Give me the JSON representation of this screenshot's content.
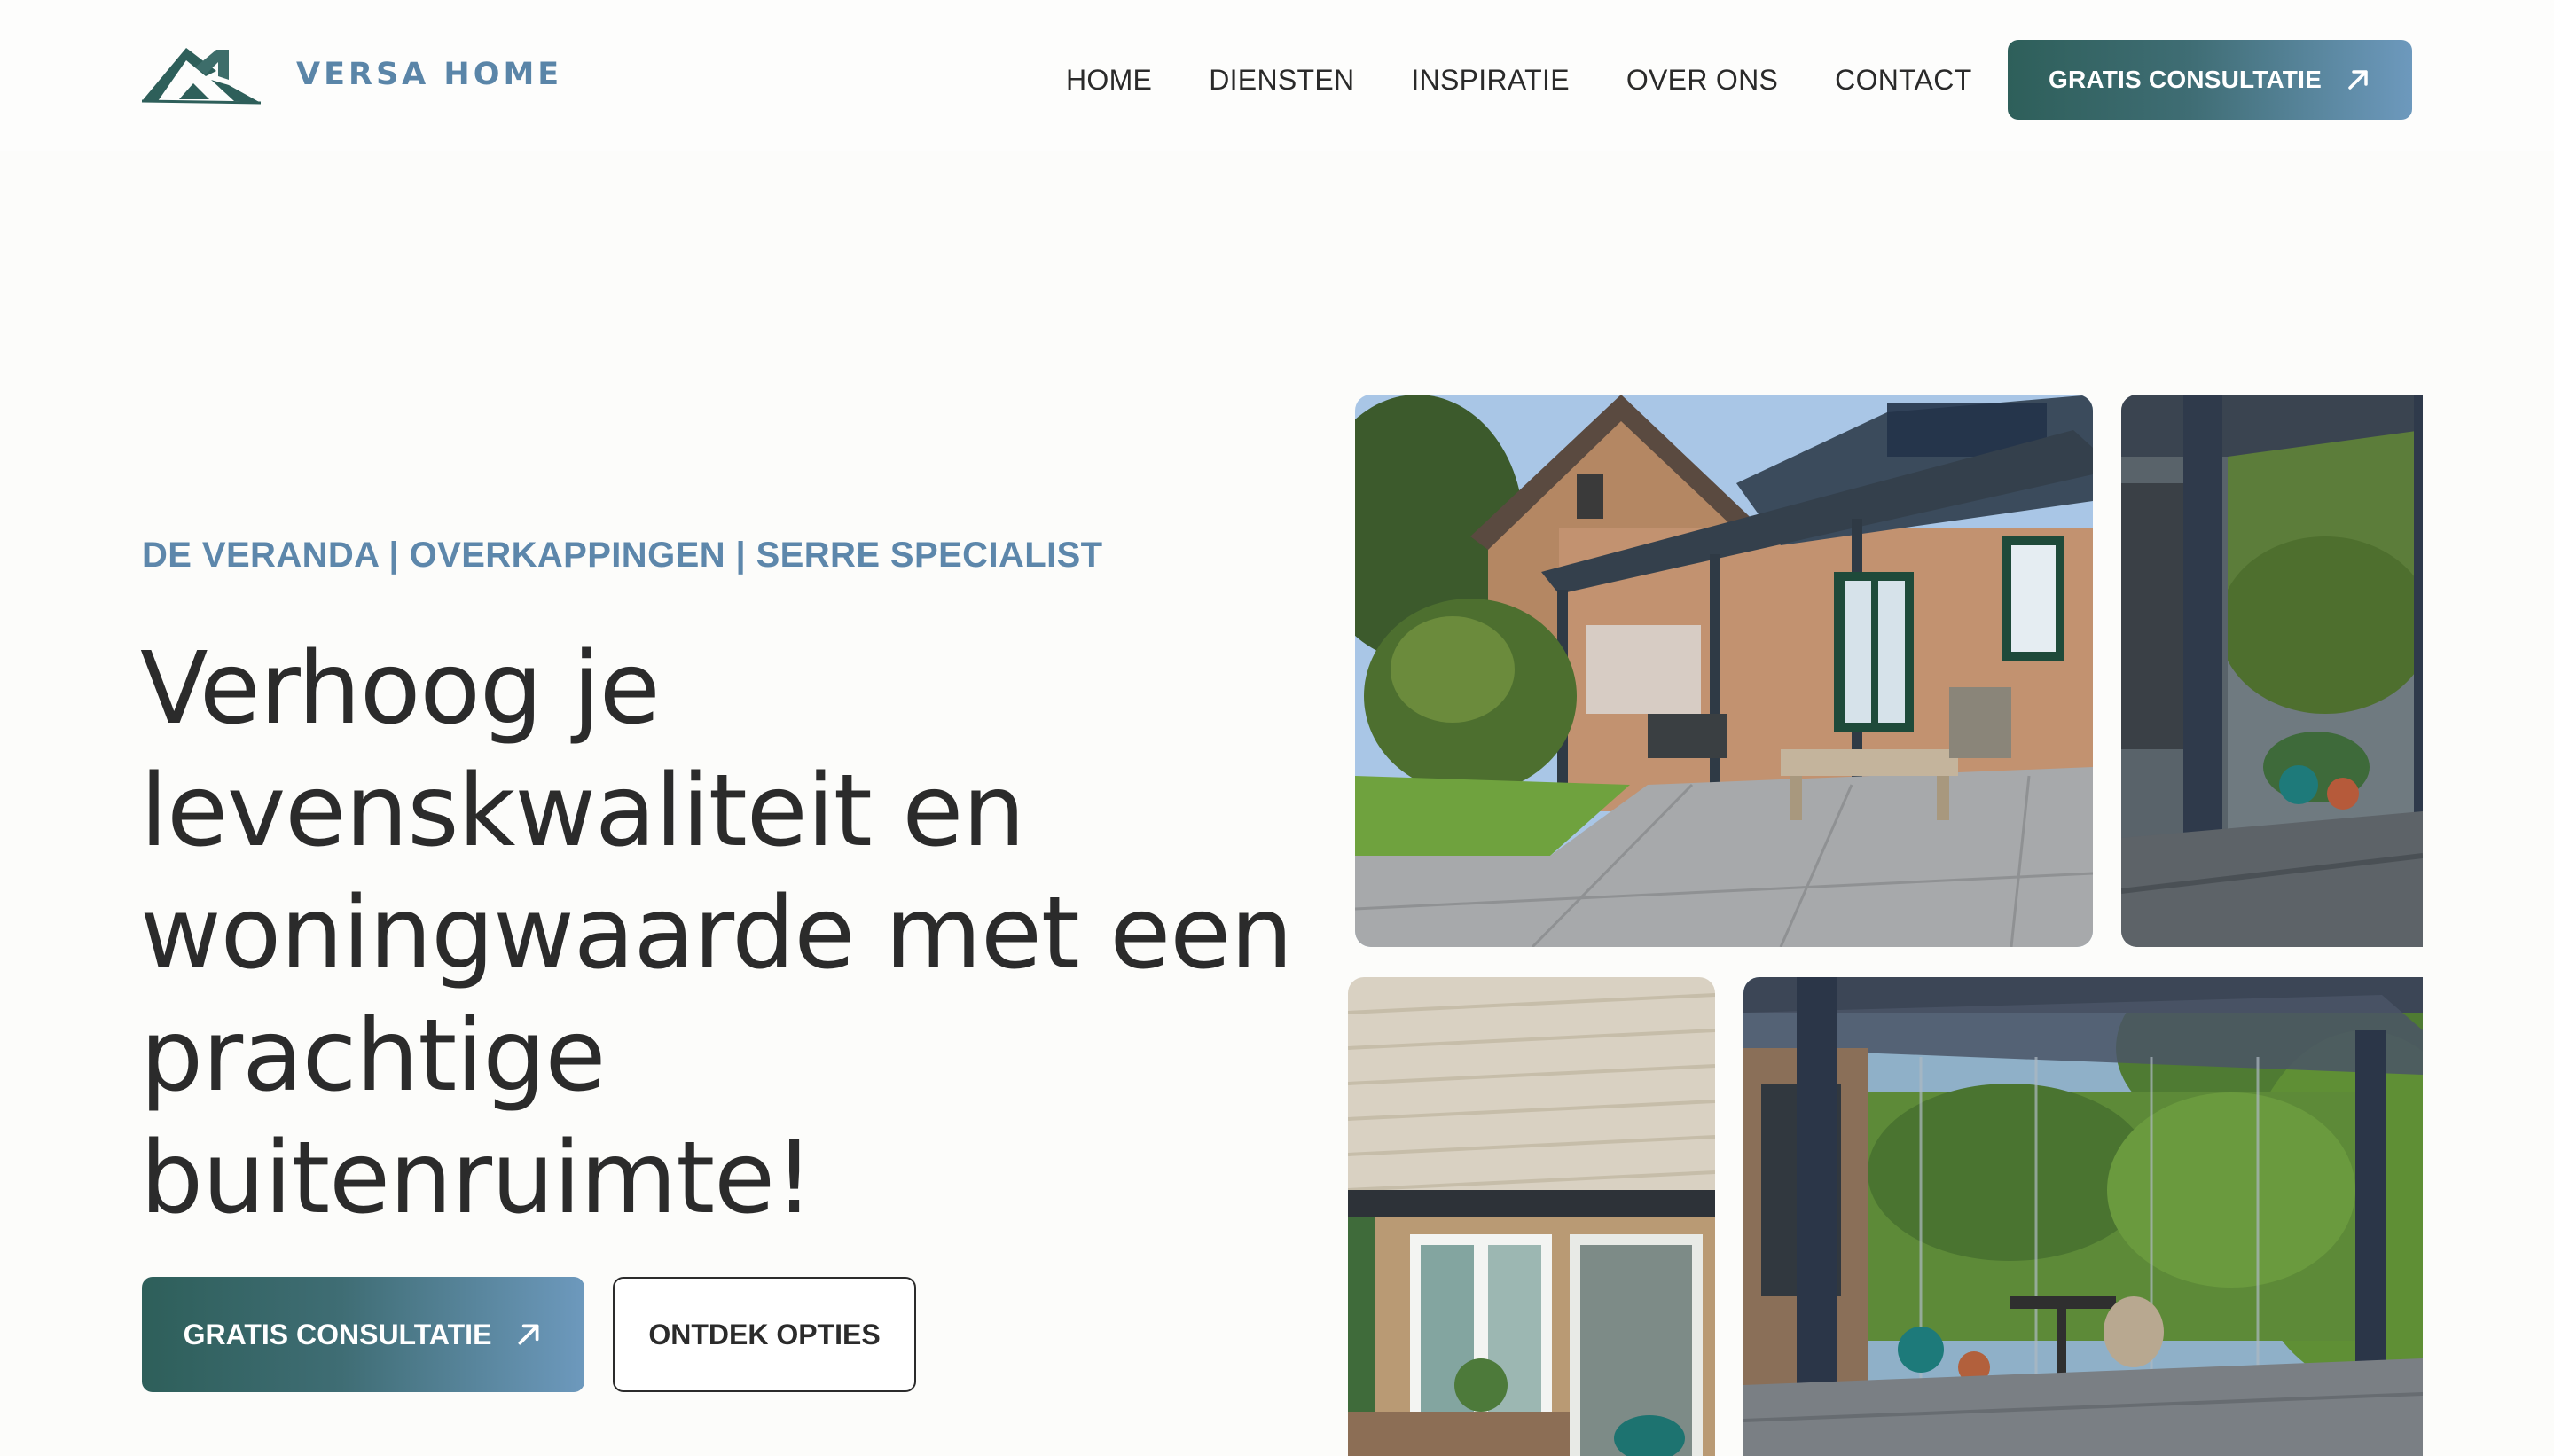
{
  "header": {
    "brand": "VERSA HOME",
    "nav": [
      "HOME",
      "DIENSTEN",
      "INSPIRATIE",
      "OVER ONS",
      "CONTACT"
    ],
    "cta_label": "GRATIS CONSULTATIE"
  },
  "hero": {
    "kicker": "DE VERANDA | OVERKAPPINGEN | SERRE SPECIALIST",
    "headline": "Verhoog je levenskwaliteit en woningwaarde met een prachtige buitenruimte!",
    "primary_button": "GRATIS CONSULTATIE",
    "secondary_button": "ONTDEK OPTIES"
  },
  "colors": {
    "brand_dark": "#2e5f5a",
    "brand_light": "#6d99bd",
    "kicker": "#5d87ab",
    "text": "#2b2b2b",
    "background": "#fcfcfa"
  },
  "icons": {
    "cta_arrow": "arrow-up-right-icon",
    "logo": "house-roof-logo-icon"
  }
}
